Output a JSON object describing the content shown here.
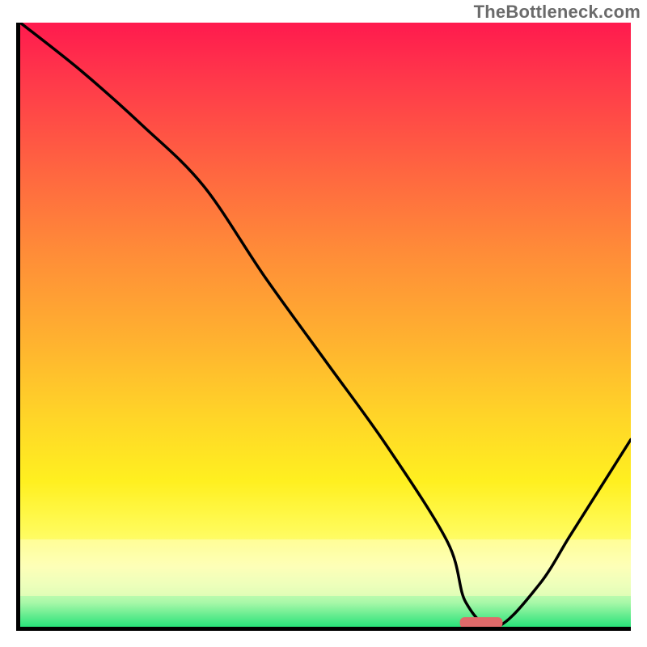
{
  "watermark": "TheBottleneck.com",
  "chart_data": {
    "type": "line",
    "title": "",
    "xlabel": "",
    "ylabel": "",
    "xlim": [
      0,
      100
    ],
    "ylim": [
      0,
      100
    ],
    "series": [
      {
        "name": "bottleneck-curve",
        "x": [
          0,
          10,
          20,
          30,
          40,
          50,
          60,
          70,
          73,
          78,
          85,
          90,
          95,
          100
        ],
        "values": [
          100,
          92,
          83,
          73,
          58,
          44,
          30,
          14,
          4,
          0,
          7,
          15,
          23,
          31
        ]
      }
    ],
    "optimal_marker": {
      "x_start": 72,
      "x_end": 79,
      "y": 0
    },
    "background_gradient": {
      "stops": [
        {
          "pos": 0.0,
          "color": "#ff1a4e"
        },
        {
          "pos": 0.25,
          "color": "#ff6740"
        },
        {
          "pos": 0.5,
          "color": "#ffb030"
        },
        {
          "pos": 0.75,
          "color": "#fff020"
        },
        {
          "pos": 1.0,
          "color": "#29e27a"
        }
      ]
    }
  }
}
